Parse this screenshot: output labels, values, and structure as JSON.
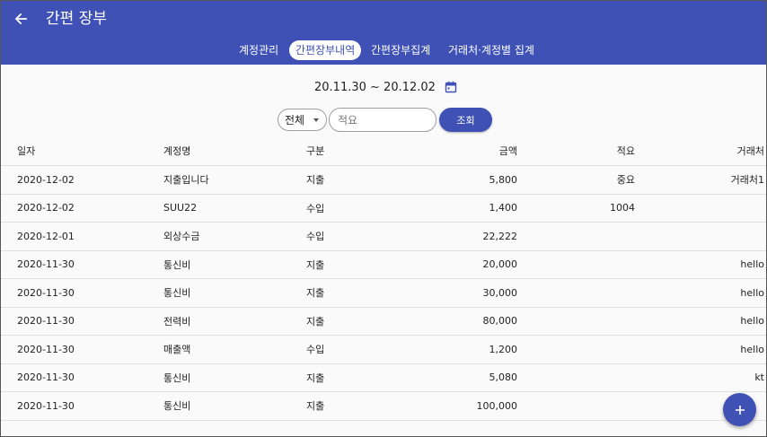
{
  "header": {
    "title": "간편 장부",
    "back_icon": "arrow-back-icon",
    "background_color": "#3f51b5"
  },
  "tabs": [
    {
      "label": "계정관리",
      "active": false
    },
    {
      "label": "간편장부내역",
      "active": true
    },
    {
      "label": "간편장부집계",
      "active": false
    },
    {
      "label": "거래처·계정별 집계",
      "active": false
    }
  ],
  "date_range": {
    "text": "20.11.30 ~ 20.12.02",
    "icon": "calendar-icon"
  },
  "filter": {
    "select_value": "전체",
    "memo_placeholder": "적요",
    "search_label": "조회"
  },
  "table": {
    "columns": [
      "일자",
      "계정명",
      "구분",
      "금액",
      "적요",
      "거래처"
    ],
    "rows": [
      {
        "date": "2020-12-02",
        "account": "지출입니다",
        "type": "지출",
        "amount": "5,800",
        "memo": "중요",
        "vendor": "거래처1"
      },
      {
        "date": "2020-12-02",
        "account": "SUU22",
        "type": "수입",
        "amount": "1,400",
        "memo": "1004",
        "vendor": ""
      },
      {
        "date": "2020-12-01",
        "account": "외상수금",
        "type": "수입",
        "amount": "22,222",
        "memo": "",
        "vendor": ""
      },
      {
        "date": "2020-11-30",
        "account": "통신비",
        "type": "지출",
        "amount": "20,000",
        "memo": "",
        "vendor": "hello"
      },
      {
        "date": "2020-11-30",
        "account": "통신비",
        "type": "지출",
        "amount": "30,000",
        "memo": "",
        "vendor": "hello"
      },
      {
        "date": "2020-11-30",
        "account": "전력비",
        "type": "지출",
        "amount": "80,000",
        "memo": "",
        "vendor": "hello"
      },
      {
        "date": "2020-11-30",
        "account": "매출액",
        "type": "수입",
        "amount": "1,200",
        "memo": "",
        "vendor": "hello"
      },
      {
        "date": "2020-11-30",
        "account": "통신비",
        "type": "지출",
        "amount": "5,080",
        "memo": "",
        "vendor": "kt"
      },
      {
        "date": "2020-11-30",
        "account": "통신비",
        "type": "지출",
        "amount": "100,000",
        "memo": "",
        "vendor": ""
      }
    ]
  },
  "fab": {
    "icon": "plus-icon",
    "label": "+"
  }
}
